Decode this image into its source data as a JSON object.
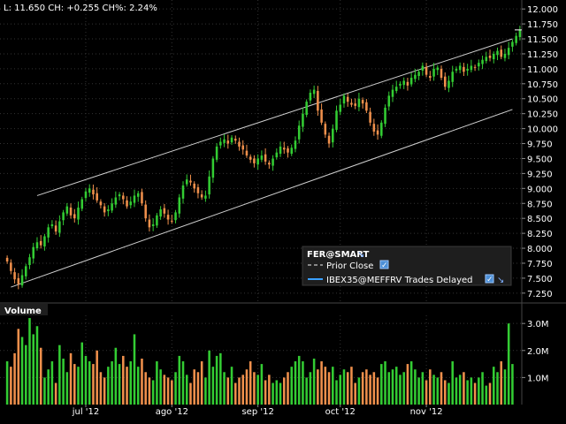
{
  "quote_line": "L: 11.650  CH: +0.255  CH%: 2.24%",
  "legend": {
    "symbol": "FER@SMART",
    "items": [
      {
        "label": "Prior Close",
        "style": "dashed",
        "color": "#aaaaaa",
        "checked": true
      },
      {
        "label": "IBEX35@MEFFRV Trades Delayed",
        "style": "solid",
        "color": "#3aa0ff",
        "checked": true
      }
    ]
  },
  "volume_panel": {
    "title": "Volume"
  },
  "colors": {
    "up": "#33cc33",
    "down": "#f0904c",
    "channel": "#d0d0d0",
    "background": "#000000",
    "grid": "#333333"
  },
  "chart_data": [
    {
      "type": "candlestick",
      "title": "FER@SMART",
      "yticks": [
        7.25,
        7.5,
        7.75,
        8.0,
        8.25,
        8.5,
        8.75,
        9.0,
        9.25,
        9.5,
        9.75,
        10.0,
        10.25,
        10.5,
        10.75,
        11.0,
        11.25,
        11.5,
        11.75,
        12.0
      ],
      "ytick_labels": [
        "7.250",
        "7.500",
        "7.750",
        "8.000",
        "8.250",
        "8.500",
        "8.750",
        "9.000",
        "9.250",
        "9.500",
        "9.750",
        "10.000",
        "10.250",
        "10.500",
        "10.750",
        "11.000",
        "11.250",
        "11.500",
        "11.750",
        "12.000"
      ],
      "ylim": [
        7.1,
        12.15
      ],
      "xtick_labels": [
        "jul '12",
        "ago '12",
        "sep '12",
        "oct '12",
        "nov '12"
      ],
      "xtick_index": [
        21,
        44,
        67,
        89,
        112
      ],
      "grid": true,
      "channel": {
        "upper": [
          {
            "i": 8,
            "y": 8.88
          },
          {
            "i": 135,
            "y": 11.5
          }
        ],
        "lower": [
          {
            "i": 1,
            "y": 7.35
          },
          {
            "i": 135,
            "y": 10.32
          }
        ]
      },
      "last": 11.65,
      "closes": [
        7.78,
        7.62,
        7.48,
        7.4,
        7.55,
        7.7,
        7.85,
        8.02,
        8.1,
        8.05,
        8.2,
        8.35,
        8.4,
        8.28,
        8.45,
        8.6,
        8.7,
        8.55,
        8.5,
        8.68,
        8.82,
        8.95,
        9.0,
        8.9,
        8.8,
        8.72,
        8.6,
        8.65,
        8.75,
        8.85,
        8.9,
        8.82,
        8.7,
        8.78,
        8.88,
        8.92,
        8.75,
        8.5,
        8.35,
        8.4,
        8.55,
        8.65,
        8.58,
        8.48,
        8.45,
        8.6,
        8.85,
        9.05,
        9.15,
        9.1,
        9.0,
        8.92,
        8.85,
        8.88,
        9.2,
        9.5,
        9.7,
        9.78,
        9.82,
        9.75,
        9.85,
        9.8,
        9.7,
        9.65,
        9.55,
        9.48,
        9.42,
        9.5,
        9.55,
        9.45,
        9.4,
        9.5,
        9.6,
        9.7,
        9.65,
        9.6,
        9.68,
        9.8,
        10.05,
        10.25,
        10.45,
        10.6,
        10.65,
        10.3,
        10.1,
        9.9,
        9.75,
        10.0,
        10.3,
        10.4,
        10.55,
        10.45,
        10.4,
        10.38,
        10.5,
        10.42,
        10.3,
        10.1,
        9.95,
        9.9,
        10.1,
        10.35,
        10.55,
        10.65,
        10.7,
        10.75,
        10.8,
        10.72,
        10.85,
        10.9,
        10.95,
        11.05,
        10.9,
        10.85,
        11.0,
        11.02,
        10.85,
        10.7,
        10.8,
        10.95,
        11.0,
        11.05,
        10.95,
        11.0,
        11.05,
        11.02,
        11.1,
        11.15,
        11.2,
        11.18,
        11.25,
        11.3,
        11.2,
        11.25,
        11.35,
        11.45,
        11.55,
        11.65
      ],
      "volumes": [
        1.6,
        1.4,
        1.9,
        2.8,
        2.5,
        2.2,
        3.2,
        2.6,
        2.9,
        2.1,
        1.0,
        1.3,
        1.6,
        0.8,
        2.2,
        1.7,
        1.2,
        1.9,
        1.5,
        1.4,
        2.3,
        1.8,
        1.6,
        1.5,
        2.0,
        1.2,
        1.0,
        1.4,
        1.6,
        2.1,
        1.5,
        1.8,
        1.4,
        1.6,
        2.6,
        1.4,
        1.7,
        1.2,
        1.0,
        0.9,
        1.6,
        1.3,
        1.1,
        1.0,
        0.9,
        1.2,
        1.8,
        1.6,
        1.1,
        0.8,
        1.3,
        1.2,
        1.6,
        1.0,
        2.0,
        1.4,
        1.8,
        1.9,
        1.2,
        1.0,
        1.4,
        0.8,
        1.0,
        1.1,
        1.3,
        1.6,
        1.2,
        1.1,
        1.5,
        0.9,
        1.1,
        0.8,
        0.9,
        0.8,
        1.0,
        1.2,
        1.4,
        1.6,
        1.8,
        1.6,
        1.0,
        1.2,
        1.7,
        1.3,
        1.6,
        1.4,
        1.2,
        1.4,
        0.9,
        1.1,
        1.3,
        1.2,
        1.4,
        0.8,
        1.0,
        1.2,
        1.3,
        1.1,
        1.2,
        1.0,
        1.5,
        1.6,
        1.2,
        1.3,
        1.4,
        1.1,
        1.2,
        1.5,
        1.6,
        1.3,
        1.0,
        1.2,
        0.9,
        1.3,
        1.1,
        1.0,
        1.2,
        0.9,
        0.8,
        1.6,
        1.0,
        1.1,
        1.2,
        0.9,
        1.0,
        0.8,
        1.0,
        1.2,
        0.7,
        0.8,
        1.4,
        1.2,
        1.6,
        1.3,
        3.0,
        1.5
      ],
      "volume_ticks": [
        1.0,
        2.0,
        3.0
      ],
      "volume_tick_labels": [
        "1.0M",
        "2.0M",
        "3.0M"
      ],
      "volume_ylim": [
        0,
        3.3
      ]
    }
  ]
}
